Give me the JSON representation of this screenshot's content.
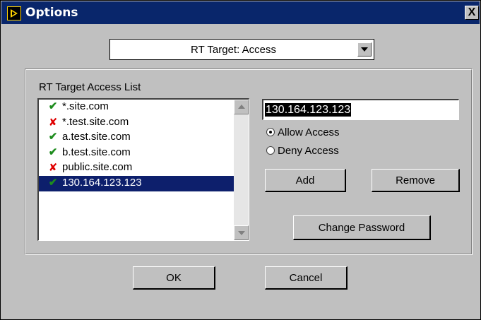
{
  "window": {
    "title": "Options",
    "close_label": "X"
  },
  "category_select": {
    "value": "RT Target: Access"
  },
  "access_group": {
    "label": "RT Target Access List"
  },
  "access_list": {
    "items": [
      {
        "status": "allow",
        "label": "*.site.com",
        "selected": false
      },
      {
        "status": "deny",
        "label": "*.test.site.com",
        "selected": false
      },
      {
        "status": "allow",
        "label": "a.test.site.com",
        "selected": false
      },
      {
        "status": "allow",
        "label": "b.test.site.com",
        "selected": false
      },
      {
        "status": "deny",
        "label": "public.site.com",
        "selected": false
      },
      {
        "status": "allow",
        "label": "130.164.123.123",
        "selected": true
      }
    ]
  },
  "address_field": {
    "value": "130.164.123.123"
  },
  "radios": {
    "allow_label": "Allow Access",
    "deny_label": "Deny Access",
    "selected": "allow"
  },
  "buttons": {
    "add": "Add",
    "remove": "Remove",
    "change_password": "Change Password",
    "ok": "OK",
    "cancel": "Cancel"
  },
  "colors": {
    "title_bar": "#09266b",
    "selection": "#0d1f6c",
    "allow": "#1e8c1e",
    "deny": "#e00000"
  }
}
